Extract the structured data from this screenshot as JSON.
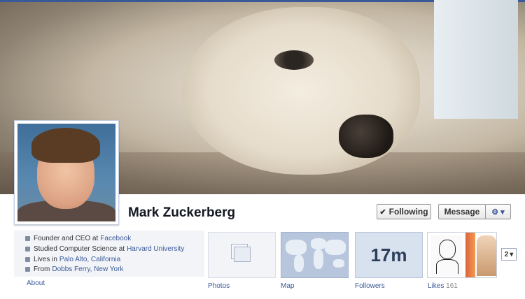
{
  "profile": {
    "name": "Mark Zuckerberg",
    "following_label": "Following",
    "following_check": "✔",
    "message_label": "Message",
    "gear_label": "⚙ ▾"
  },
  "about": {
    "rows": [
      {
        "icon": "briefcase-icon",
        "text": "Founder and CEO at",
        "link": "Facebook"
      },
      {
        "icon": "graduation-icon",
        "text": "Studied Computer Science at",
        "link": "Harvard University"
      },
      {
        "icon": "house-icon",
        "text": "Lives in",
        "link": "Palo Alto, California"
      },
      {
        "icon": "pin-icon",
        "text": "From",
        "link": "Dobbs Ferry, New York"
      }
    ],
    "label": "About"
  },
  "tiles": {
    "photos_label": "Photos",
    "map_label": "Map",
    "followers_count": "17m",
    "followers_label": "Followers",
    "likes_label": "Likes",
    "likes_count": "161",
    "more_count": "2",
    "more_arrow": "▾"
  }
}
